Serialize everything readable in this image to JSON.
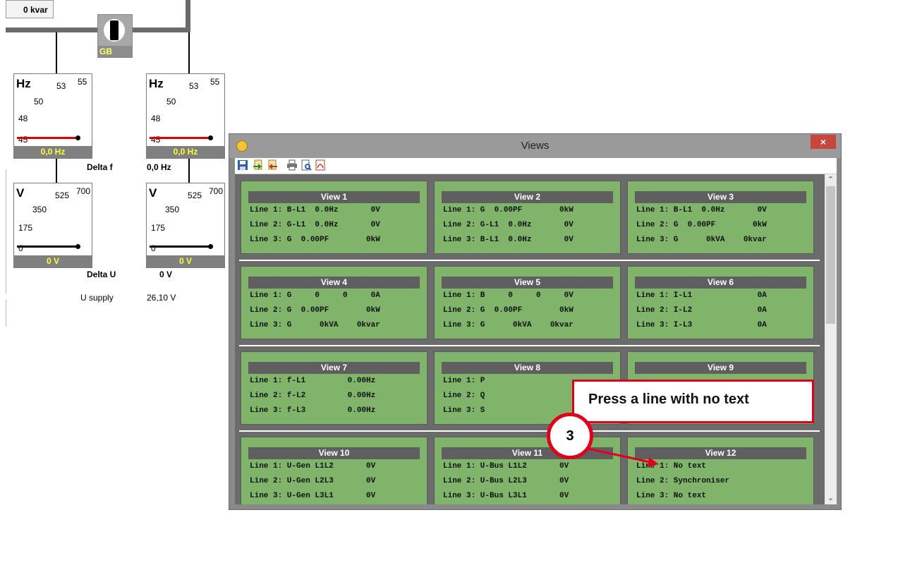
{
  "diagram": {
    "kvar_readout": "0 kvar",
    "breaker_label": "GB",
    "meters": [
      {
        "unit": "Hz",
        "ticks": [
          "55",
          "53",
          "50",
          "48",
          "45"
        ],
        "readout": "0,0 Hz"
      },
      {
        "unit": "Hz",
        "ticks": [
          "55",
          "53",
          "50",
          "48",
          "45"
        ],
        "readout": "0,0 Hz"
      },
      {
        "unit": "V",
        "ticks": [
          "700",
          "525",
          "350",
          "175",
          "0"
        ],
        "readout": "0 V"
      },
      {
        "unit": "V",
        "ticks": [
          "700",
          "525",
          "350",
          "175",
          "0"
        ],
        "readout": "0 V"
      }
    ],
    "delta_f_label": "Delta f",
    "delta_f_value": "0,0 Hz",
    "delta_u_label": "Delta U",
    "delta_u_value": "0 V",
    "u_supply_label": "U supply",
    "u_supply_value": "26,10 V",
    "colors": {
      "needle_red": "#e00000",
      "readout_text": "#ffff33"
    }
  },
  "window": {
    "title": "Views",
    "close_label": "×",
    "toolbar": [
      "save-icon",
      "import-icon",
      "export-icon",
      "print-icon",
      "print-preview-icon",
      "pdf-icon"
    ]
  },
  "views": [
    {
      "title": "View 1",
      "lines": [
        "Line 1: B-L1  0.0Hz       0V",
        "Line 2: G-L1  0.0Hz       0V",
        "Line 3: G  0.00PF        0kW"
      ]
    },
    {
      "title": "View 2",
      "lines": [
        "Line 1: G  0.00PF        0kW",
        "Line 2: G-L1  0.0Hz       0V",
        "Line 3: B-L1  0.0Hz       0V"
      ]
    },
    {
      "title": "View 3",
      "lines": [
        "Line 1: B-L1  0.0Hz       0V",
        "Line 2: G  0.00PF        0kW",
        "Line 3: G      0kVA    0kvar"
      ]
    },
    {
      "title": "View 4",
      "lines": [
        "Line 1: G     0     0     0A",
        "Line 2: G  0.00PF        0kW",
        "Line 3: G      0kVA    0kvar"
      ]
    },
    {
      "title": "View 5",
      "lines": [
        "Line 1: B     0     0     0V",
        "Line 2: G  0.00PF        0kW",
        "Line 3: G      0kVA    0kvar"
      ]
    },
    {
      "title": "View 6",
      "lines": [
        "Line 1: I-L1              0A",
        "Line 2: I-L2              0A",
        "Line 3: I-L3              0A"
      ]
    },
    {
      "title": "View 7",
      "lines": [
        "Line 1: f-L1         0.00Hz",
        "Line 2: f-L2         0.00Hz",
        "Line 3: f-L3         0.00Hz"
      ]
    },
    {
      "title": "View 8",
      "lines": [
        "Line 1: P",
        "Line 2: Q",
        "Line 3: S"
      ]
    },
    {
      "title": "View 9",
      "lines": [
        "",
        "",
        ""
      ]
    },
    {
      "title": "View 10",
      "lines": [
        "Line 1: U-Gen L1L2       0V",
        "Line 2: U-Gen L2L3       0V",
        "Line 3: U-Gen L3L1       0V"
      ]
    },
    {
      "title": "View 11",
      "lines": [
        "Line 1: U-Bus L1L2       0V",
        "Line 2: U-Bus L2L3       0V",
        "Line 3: U-Bus L3L1       0V"
      ]
    },
    {
      "title": "View 12",
      "lines": [
        "Line 1: No text",
        "Line 2: Synchroniser",
        "Line 3: No text"
      ]
    }
  ],
  "annotation": {
    "callout_text": "Press a line with no text",
    "step_number": "3",
    "color": "#e3001b"
  }
}
